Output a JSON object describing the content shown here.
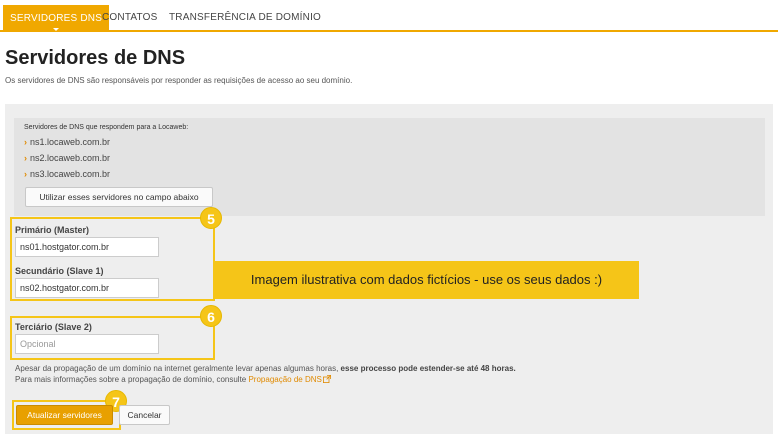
{
  "tabs": [
    {
      "label": "SERVIDORES DNS",
      "active": true
    },
    {
      "label": "CONTATOS",
      "active": false
    },
    {
      "label": "TRANSFERÊNCIA DE DOMÍNIO",
      "active": false
    }
  ],
  "header": {
    "title": "Servidores de DNS",
    "description": "Os servidores de DNS são responsáveis por responder as requisições de acesso ao seu domínio."
  },
  "locaweb": {
    "title": "Servidores de DNS que respondem para a Locaweb:",
    "servers": [
      "ns1.locaweb.com.br",
      "ns2.locaweb.com.br",
      "ns3.locaweb.com.br"
    ],
    "use_button": "Utilizar esses servidores no campo abaixo"
  },
  "form": {
    "primary": {
      "label": "Primário (Master)",
      "value": "ns01.hostgator.com.br"
    },
    "secondary": {
      "label": "Secundário (Slave 1)",
      "value": "ns02.hostgator.com.br"
    },
    "tertiary": {
      "label": "Terciário (Slave 2)",
      "placeholder": "Opcional"
    }
  },
  "badges": [
    "5",
    "6",
    "7"
  ],
  "callout": "Imagem ilustrativa com dados fictícios - use os seus dados :)",
  "info": {
    "line1_prefix": "Apesar da propagação de um domínio na internet geralmente levar apenas algumas horas, ",
    "line1_bold": "esse processo pode estender-se até 48 horas.",
    "line2_prefix": "Para mais informações sobre a propagação de domínio, consulte ",
    "line2_link": "Propagação de DNS"
  },
  "actions": {
    "submit": "Atualizar servidores",
    "cancel": "Cancelar"
  },
  "colors": {
    "accent": "#f0a800",
    "highlight": "#f5c518",
    "link": "#e08a00"
  }
}
